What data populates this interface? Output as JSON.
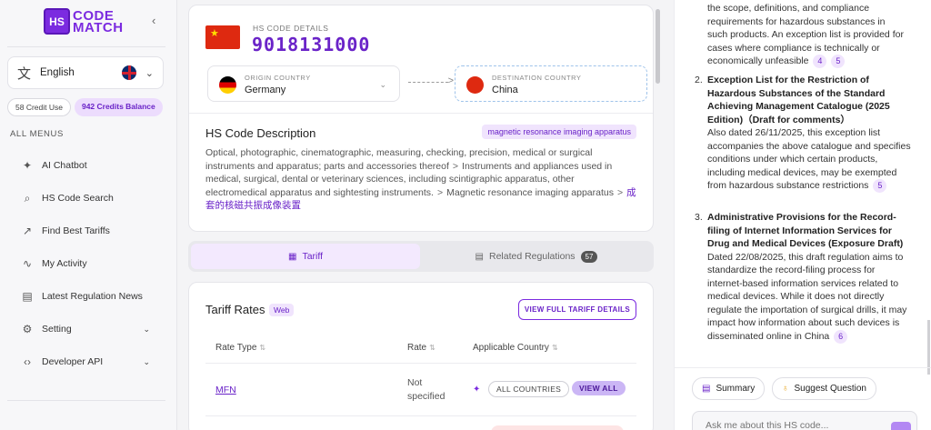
{
  "brand": {
    "logo_mark": "HS",
    "line1": "CODE",
    "line2": "MATCH"
  },
  "language": {
    "label": "English"
  },
  "credits": {
    "use": "58 Credit Use",
    "balance": "942 Credits Balance"
  },
  "menu_heading": "ALL MENUS",
  "menu": [
    {
      "label": "AI Chatbot",
      "icon": "sparkle-icon"
    },
    {
      "label": "HS Code Search",
      "icon": "search-icon"
    },
    {
      "label": "Find Best Tariffs",
      "icon": "trend-icon"
    },
    {
      "label": "My Activity",
      "icon": "activity-icon"
    },
    {
      "label": "Latest Regulation News",
      "icon": "news-icon"
    },
    {
      "label": "Setting",
      "icon": "gear-icon"
    },
    {
      "label": "Developer API",
      "icon": "code-icon"
    }
  ],
  "hs": {
    "label": "HS CODE DETAILS",
    "code": "9018131000",
    "origin": {
      "label": "ORIGIN COUNTRY",
      "value": "Germany"
    },
    "destination": {
      "label": "DESTINATION COUNTRY",
      "value": "China"
    },
    "desc_title": "HS Code Description",
    "desc_tag": "magnetic resonance imaging apparatus",
    "desc_part1": "Optical, photographic, cinematographic, measuring, checking, precision, medical or surgical instruments and apparatus; parts and accessories thereof",
    "desc_part2": "Instruments and appliances used in medical, surgical, dental or veterinary sciences, including scintigraphic apparatus, other electromedical apparatus and sightesting instruments.",
    "desc_part3": "Magnetic resonance imaging apparatus",
    "desc_cn": "成套的核磁共振成像装置",
    "sep": ">"
  },
  "tabs": {
    "tariff": "Tariff",
    "related": "Related Regulations",
    "related_count": "57"
  },
  "tariff": {
    "title": "Tariff Rates",
    "web": "Web",
    "button": "VIEW FULL TARIFF DETAILS",
    "col_rate_type": "Rate Type",
    "col_rate": "Rate",
    "col_country": "Applicable Country",
    "sort": "⇅",
    "row": {
      "type": "MFN",
      "rate": "Not specified",
      "country": "ALL COUNTRIES",
      "view": "VIEW ALL"
    }
  },
  "chat": {
    "cont_text": "the scope, definitions, and compliance requirements for hazardous substances in such products. An exception list is provided for cases where compliance is technically or economically unfeasible",
    "cont_cites": [
      "4",
      "5"
    ],
    "items": [
      {
        "num": "2.",
        "title": "Exception List for the Restriction of Hazardous Substances of the Standard Achieving Management Catalogue (2025 Edition)（Draft for comments）",
        "text": "Also dated 26/11/2025, this exception list accompanies the above catalogue and specifies conditions under which certain products, including medical devices, may be exempted from hazardous substance restrictions",
        "cite": "5"
      },
      {
        "num": "3.",
        "title": "Administrative Provisions for the Record-filing of Internet Information Services for Drug and Medical Devices (Exposure Draft)",
        "text": "Dated 22/08/2025, this draft regulation aims to standardize the record-filing process for internet-based information services related to medical devices. While it does not directly regulate the importation of surgical drills, it may impact how information about such devices is disseminated online in China",
        "cite": "6"
      }
    ],
    "summary": "Summary",
    "suggest": "Suggest Question",
    "input_placeholder": "Ask me about this HS code..."
  }
}
